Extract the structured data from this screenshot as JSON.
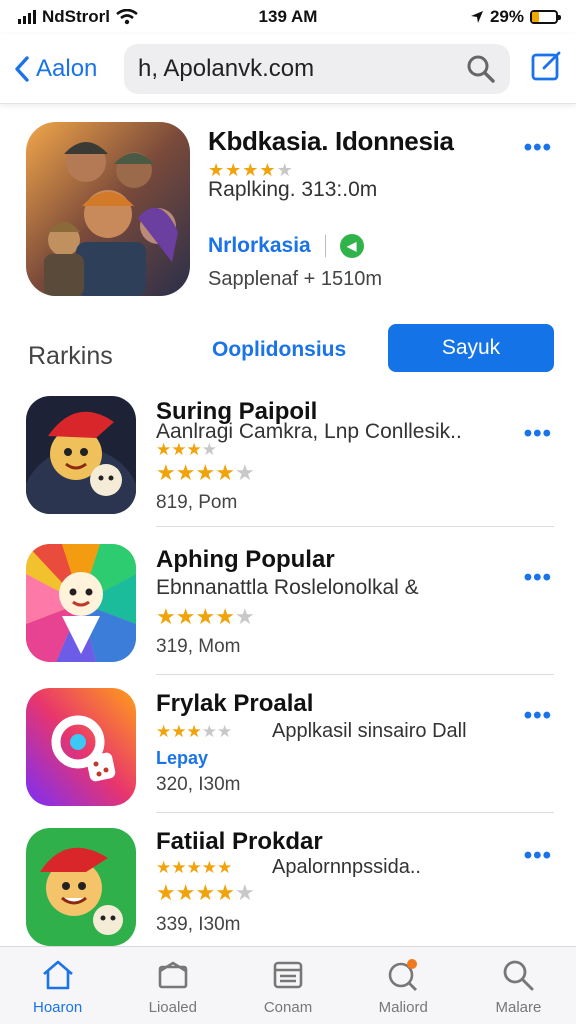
{
  "status_bar": {
    "carrier": "NdStrorl",
    "time": "139 AM",
    "battery": "29%",
    "battery_level": 0.29
  },
  "nav": {
    "back_label": "Aalon",
    "search_value": "h, Apolanvk.com"
  },
  "featured": {
    "title": "Kbdkasia. Idonnesia",
    "stars": 4,
    "rank": "Raplking. 313:.0m",
    "developer": "Nrlorkasia",
    "size": "Sapplenaf + 1510m"
  },
  "segments": {
    "label": "Rarkins",
    "tab": "Ooplidonsius",
    "button": "Sayuk"
  },
  "apps": [
    {
      "title": "Suring Paipoil",
      "subtitle": "Aanlragi Camkra, Lnp Conllesik..",
      "stars": 3,
      "stars2": 4,
      "size": "819, Pom"
    },
    {
      "title": "Aphing Popular",
      "subtitle": "Ebnnanattla Roslelonolkal &",
      "stars": 4,
      "size": "319, Mom"
    },
    {
      "title": "Frylak Proalal",
      "subtitle": "Applkasil sinsairo Dall",
      "stars": 3,
      "link": "Lepay",
      "size": "320, I30m"
    },
    {
      "title": "Fatiial Prokdar",
      "subtitle": "Apalornnpssida..",
      "stars": 5,
      "stars2": 4,
      "size": "339, I30m"
    }
  ],
  "tabs": [
    {
      "label": "Hoaron",
      "icon": "home-icon",
      "active": true
    },
    {
      "label": "Lioaled",
      "icon": "updates-icon",
      "active": false
    },
    {
      "label": "Conam",
      "icon": "games-icon",
      "active": false
    },
    {
      "label": "Maliord",
      "icon": "notification-icon",
      "active": false
    },
    {
      "label": "Malare",
      "icon": "search-icon",
      "active": false
    }
  ],
  "colors": {
    "accent": "#1a73e8",
    "star": "#f0a30a",
    "button": "#1473e6"
  }
}
